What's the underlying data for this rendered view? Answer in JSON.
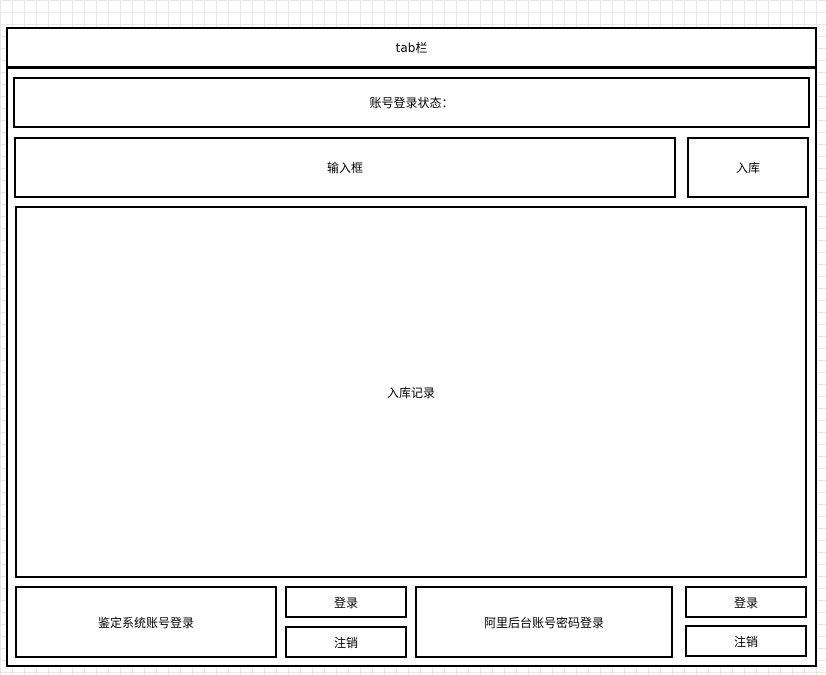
{
  "tab_bar": {
    "label": "tab栏"
  },
  "login_status": {
    "label": "账号登录状态："
  },
  "input": {
    "label": "输入框"
  },
  "store_button": {
    "label": "入库"
  },
  "records": {
    "label": "入库记录"
  },
  "appraisal_login": {
    "label": "鉴定系统账号登录",
    "login_label": "登录",
    "logout_label": "注销"
  },
  "ali_login": {
    "label": "阿里后台账号密码登录",
    "login_label": "登录",
    "logout_label": "注销"
  }
}
